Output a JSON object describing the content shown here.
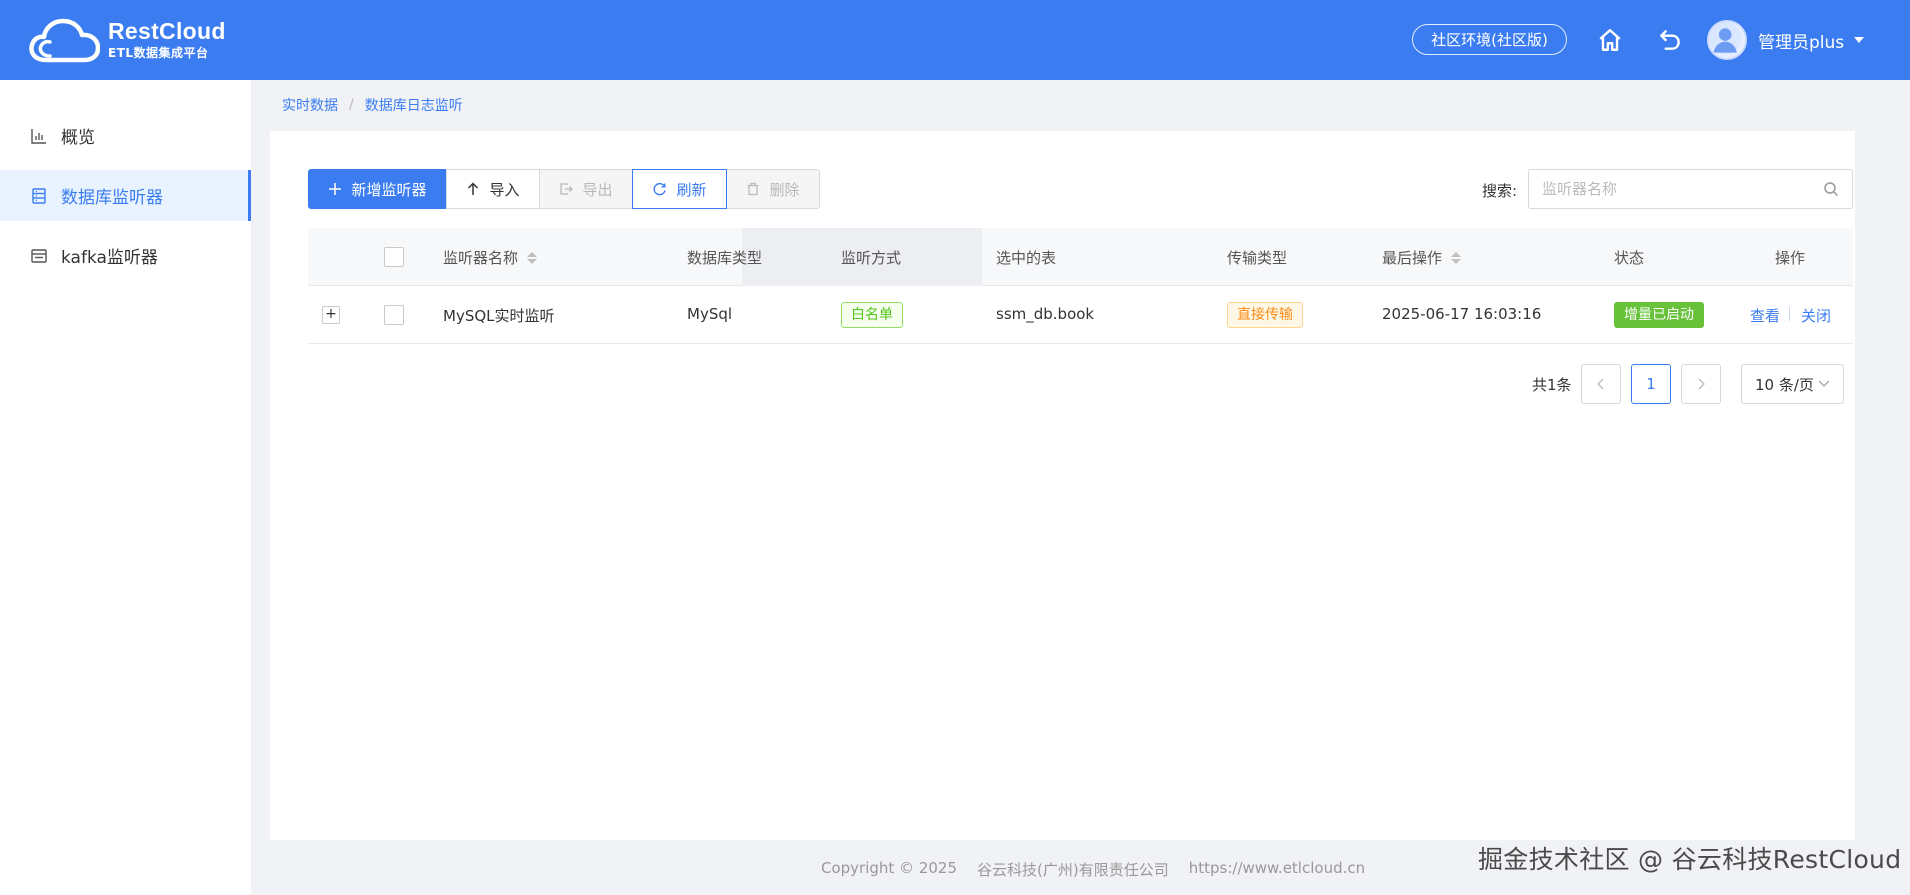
{
  "header": {
    "logo_title": "RestCloud",
    "logo_subtitle": "ETL数据集成平台",
    "env_badge": "社区环境(社区版)",
    "home_icon": "home-icon",
    "back_icon": "undo-icon",
    "user_name": "管理员plus",
    "accent_color": "#3b7df0"
  },
  "sidebar": {
    "items": [
      {
        "label": "概览",
        "icon": "bar-chart-icon",
        "active": false
      },
      {
        "label": "数据库监听器",
        "icon": "database-icon",
        "active": true
      },
      {
        "label": "kafka监听器",
        "icon": "kafka-icon",
        "active": false
      }
    ]
  },
  "breadcrumb": [
    "实时数据",
    "数据库日志监听"
  ],
  "toolbar": {
    "add_label": "新增监听器",
    "import_label": "导入",
    "export_label": "导出",
    "refresh_label": "刷新",
    "delete_label": "删除"
  },
  "search": {
    "label": "搜索:",
    "placeholder": "监听器名称"
  },
  "table": {
    "columns": [
      "监听器名称",
      "数据库类型",
      "监听方式",
      "选中的表",
      "传输类型",
      "最后操作",
      "状态",
      "操作"
    ],
    "rows": [
      {
        "expand": "+",
        "name": "MySQL实时监听",
        "db_type": "MySql",
        "listen_mode": "白名单",
        "tables": "ssm_db.book",
        "transfer_type": "直接传输",
        "last_op": "2025-06-17 16:03:16",
        "status": "增量已启动",
        "actions": [
          "查看",
          "关闭"
        ]
      }
    ]
  },
  "pagination": {
    "total": "共1条",
    "prev": "<",
    "current": "1",
    "next": ">",
    "page_size": "10 条/页"
  },
  "footer": {
    "copyright": "Copyright © 2025",
    "company": "谷云科技(广州)有限责任公司",
    "url": "https://www.etlcloud.cn"
  },
  "watermark": "掘金技术社区 @ 谷云科技RestCloud"
}
